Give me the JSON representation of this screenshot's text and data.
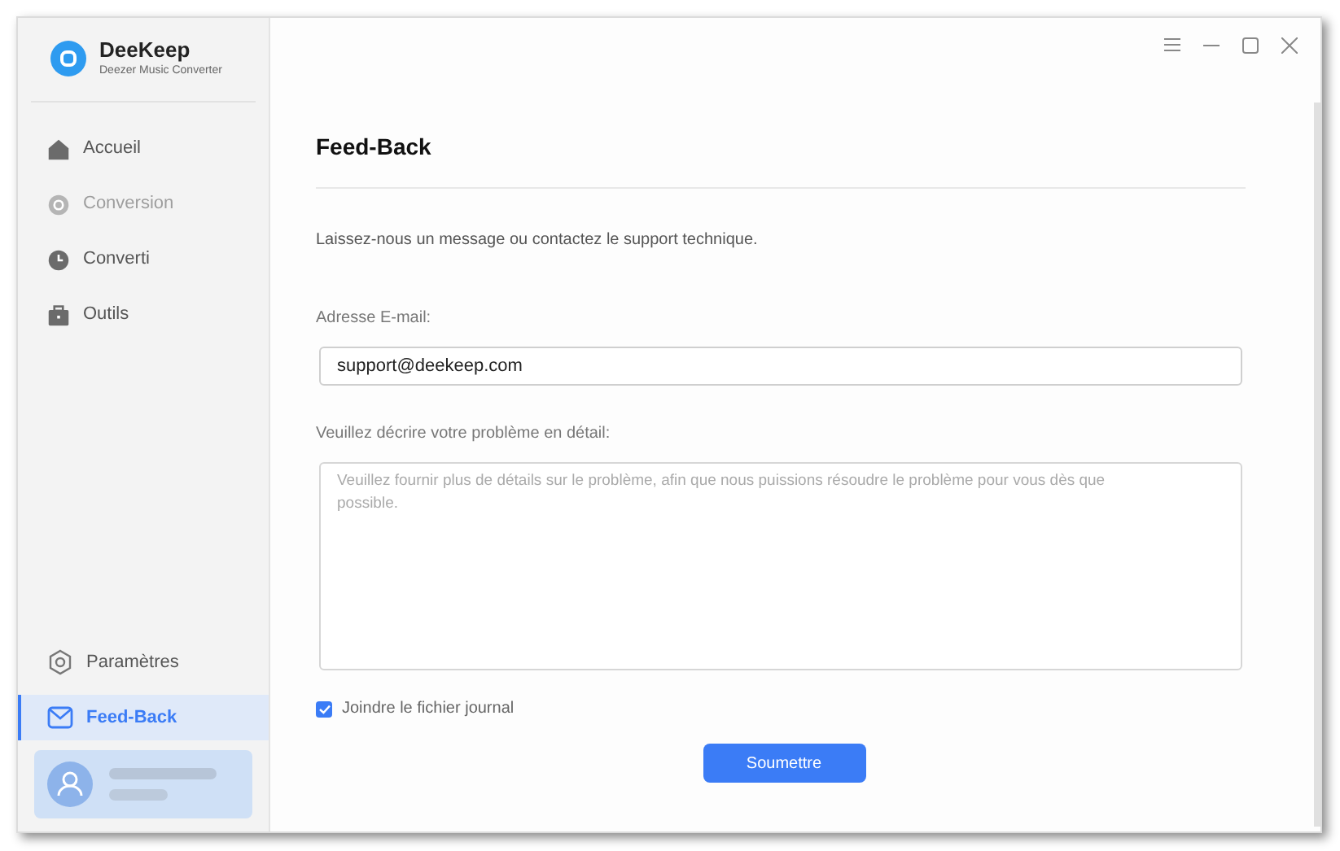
{
  "app": {
    "name": "DeeKeep",
    "subtitle": "Deezer Music Converter"
  },
  "sidebar": {
    "items": [
      {
        "label": "Accueil",
        "selected": false,
        "disabled": false
      },
      {
        "label": "Conversion",
        "selected": false,
        "disabled": true
      },
      {
        "label": "Converti",
        "selected": false,
        "disabled": false
      },
      {
        "label": "Outils",
        "selected": false,
        "disabled": false
      }
    ],
    "bottom_items": [
      {
        "label": "Paramètres",
        "selected": false
      },
      {
        "label": "Feed-Back",
        "selected": true
      }
    ]
  },
  "page": {
    "title": "Feed-Back",
    "intro": "Laissez-nous un message ou contactez le support technique.",
    "email_label": "Adresse E-mail:",
    "email_value": "support@deekeep.com",
    "description_label": "Veuillez décrire votre problème en détail:",
    "description_placeholder": "Veuillez fournir plus de détails sur le problème, afin que nous puissions résoudre le problème pour vous dès que possible.",
    "attach_log": {
      "label": "Joindre le fichier journal",
      "checked": true
    },
    "submit": "Soumettre"
  }
}
